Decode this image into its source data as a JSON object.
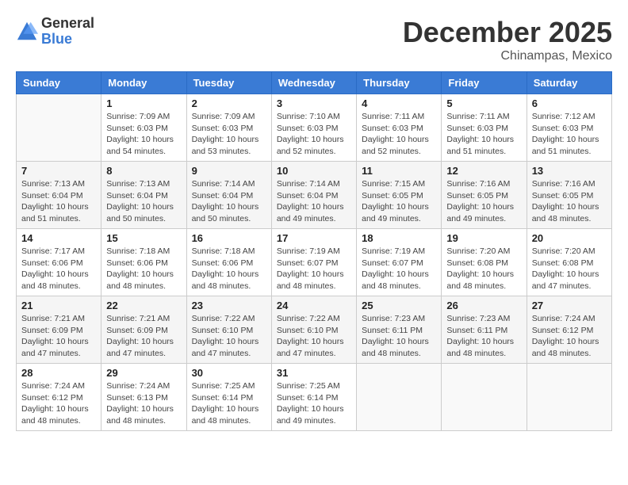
{
  "logo": {
    "general": "General",
    "blue": "Blue"
  },
  "title": "December 2025",
  "subtitle": "Chinampas, Mexico",
  "days_of_week": [
    "Sunday",
    "Monday",
    "Tuesday",
    "Wednesday",
    "Thursday",
    "Friday",
    "Saturday"
  ],
  "weeks": [
    [
      {
        "day": "",
        "info": ""
      },
      {
        "day": "1",
        "info": "Sunrise: 7:09 AM\nSunset: 6:03 PM\nDaylight: 10 hours\nand 54 minutes."
      },
      {
        "day": "2",
        "info": "Sunrise: 7:09 AM\nSunset: 6:03 PM\nDaylight: 10 hours\nand 53 minutes."
      },
      {
        "day": "3",
        "info": "Sunrise: 7:10 AM\nSunset: 6:03 PM\nDaylight: 10 hours\nand 52 minutes."
      },
      {
        "day": "4",
        "info": "Sunrise: 7:11 AM\nSunset: 6:03 PM\nDaylight: 10 hours\nand 52 minutes."
      },
      {
        "day": "5",
        "info": "Sunrise: 7:11 AM\nSunset: 6:03 PM\nDaylight: 10 hours\nand 51 minutes."
      },
      {
        "day": "6",
        "info": "Sunrise: 7:12 AM\nSunset: 6:03 PM\nDaylight: 10 hours\nand 51 minutes."
      }
    ],
    [
      {
        "day": "7",
        "info": "Sunrise: 7:13 AM\nSunset: 6:04 PM\nDaylight: 10 hours\nand 51 minutes."
      },
      {
        "day": "8",
        "info": "Sunrise: 7:13 AM\nSunset: 6:04 PM\nDaylight: 10 hours\nand 50 minutes."
      },
      {
        "day": "9",
        "info": "Sunrise: 7:14 AM\nSunset: 6:04 PM\nDaylight: 10 hours\nand 50 minutes."
      },
      {
        "day": "10",
        "info": "Sunrise: 7:14 AM\nSunset: 6:04 PM\nDaylight: 10 hours\nand 49 minutes."
      },
      {
        "day": "11",
        "info": "Sunrise: 7:15 AM\nSunset: 6:05 PM\nDaylight: 10 hours\nand 49 minutes."
      },
      {
        "day": "12",
        "info": "Sunrise: 7:16 AM\nSunset: 6:05 PM\nDaylight: 10 hours\nand 49 minutes."
      },
      {
        "day": "13",
        "info": "Sunrise: 7:16 AM\nSunset: 6:05 PM\nDaylight: 10 hours\nand 48 minutes."
      }
    ],
    [
      {
        "day": "14",
        "info": "Sunrise: 7:17 AM\nSunset: 6:06 PM\nDaylight: 10 hours\nand 48 minutes."
      },
      {
        "day": "15",
        "info": "Sunrise: 7:18 AM\nSunset: 6:06 PM\nDaylight: 10 hours\nand 48 minutes."
      },
      {
        "day": "16",
        "info": "Sunrise: 7:18 AM\nSunset: 6:06 PM\nDaylight: 10 hours\nand 48 minutes."
      },
      {
        "day": "17",
        "info": "Sunrise: 7:19 AM\nSunset: 6:07 PM\nDaylight: 10 hours\nand 48 minutes."
      },
      {
        "day": "18",
        "info": "Sunrise: 7:19 AM\nSunset: 6:07 PM\nDaylight: 10 hours\nand 48 minutes."
      },
      {
        "day": "19",
        "info": "Sunrise: 7:20 AM\nSunset: 6:08 PM\nDaylight: 10 hours\nand 48 minutes."
      },
      {
        "day": "20",
        "info": "Sunrise: 7:20 AM\nSunset: 6:08 PM\nDaylight: 10 hours\nand 47 minutes."
      }
    ],
    [
      {
        "day": "21",
        "info": "Sunrise: 7:21 AM\nSunset: 6:09 PM\nDaylight: 10 hours\nand 47 minutes."
      },
      {
        "day": "22",
        "info": "Sunrise: 7:21 AM\nSunset: 6:09 PM\nDaylight: 10 hours\nand 47 minutes."
      },
      {
        "day": "23",
        "info": "Sunrise: 7:22 AM\nSunset: 6:10 PM\nDaylight: 10 hours\nand 47 minutes."
      },
      {
        "day": "24",
        "info": "Sunrise: 7:22 AM\nSunset: 6:10 PM\nDaylight: 10 hours\nand 47 minutes."
      },
      {
        "day": "25",
        "info": "Sunrise: 7:23 AM\nSunset: 6:11 PM\nDaylight: 10 hours\nand 48 minutes."
      },
      {
        "day": "26",
        "info": "Sunrise: 7:23 AM\nSunset: 6:11 PM\nDaylight: 10 hours\nand 48 minutes."
      },
      {
        "day": "27",
        "info": "Sunrise: 7:24 AM\nSunset: 6:12 PM\nDaylight: 10 hours\nand 48 minutes."
      }
    ],
    [
      {
        "day": "28",
        "info": "Sunrise: 7:24 AM\nSunset: 6:12 PM\nDaylight: 10 hours\nand 48 minutes."
      },
      {
        "day": "29",
        "info": "Sunrise: 7:24 AM\nSunset: 6:13 PM\nDaylight: 10 hours\nand 48 minutes."
      },
      {
        "day": "30",
        "info": "Sunrise: 7:25 AM\nSunset: 6:14 PM\nDaylight: 10 hours\nand 48 minutes."
      },
      {
        "day": "31",
        "info": "Sunrise: 7:25 AM\nSunset: 6:14 PM\nDaylight: 10 hours\nand 49 minutes."
      },
      {
        "day": "",
        "info": ""
      },
      {
        "day": "",
        "info": ""
      },
      {
        "day": "",
        "info": ""
      }
    ]
  ]
}
